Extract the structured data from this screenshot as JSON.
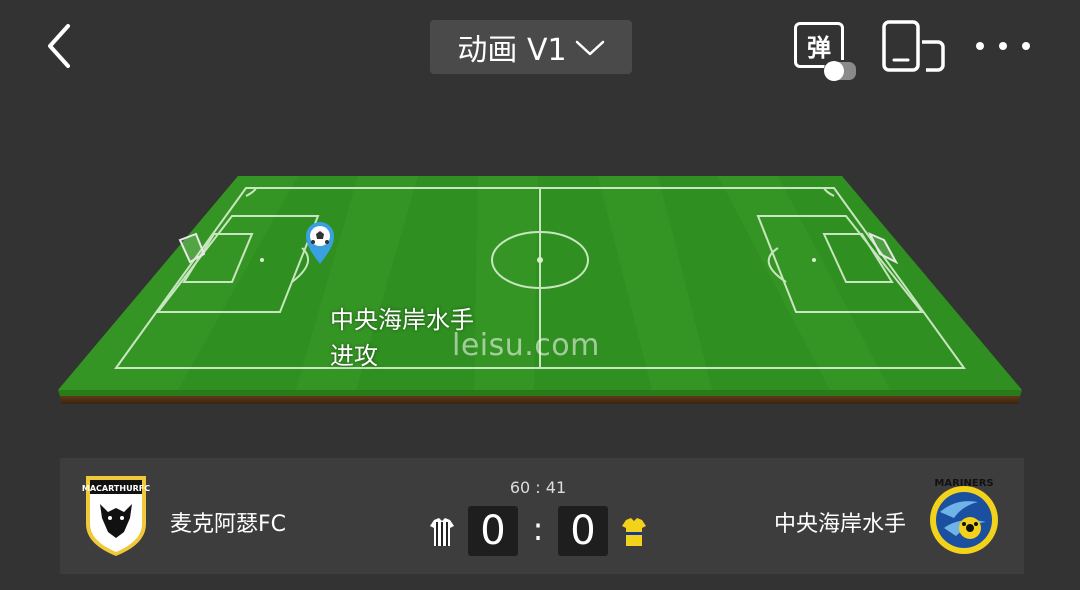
{
  "header": {
    "title": "动画 V1",
    "danmu_label": "弹"
  },
  "pitch": {
    "attack_team": "中央海岸水手",
    "attack_action": "进攻",
    "watermark": "leisu.com"
  },
  "match": {
    "clock": "60 : 41",
    "home": {
      "name": "麦克阿瑟FC",
      "logo_text": "MACARTHURFC",
      "score": "0",
      "kit_colors": [
        "#ffffff",
        "#222222"
      ]
    },
    "away": {
      "name": "中央海岸水手",
      "logo_text": "MARINERS",
      "score": "0",
      "kit_colors": [
        "#f2d21b",
        "#1b3a8a"
      ]
    },
    "separator": ":"
  },
  "colors": {
    "background": "#333333",
    "scorebar": "#3d3d3d",
    "pitch_green": "#2e8b1f",
    "attack_marker": "#3aa0e0"
  },
  "icons": {
    "back": "chevron-left-icon",
    "title_dropdown": "chevron-down-icon",
    "danmu": "danmu-toggle-icon",
    "rotate": "rotate-screen-icon",
    "more": "more-dots-icon",
    "ball_marker": "ball-marker-icon"
  }
}
